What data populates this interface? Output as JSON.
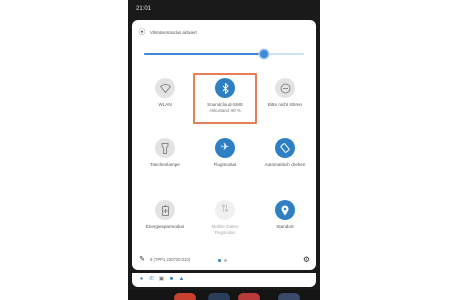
{
  "status_bar": {
    "time": "21:01"
  },
  "vibrate": {
    "label": "Vibrationsmodus aktiviert",
    "icon": "vibrate-icon"
  },
  "brightness": {
    "level": 0.75,
    "track_color": "#cfe2f3",
    "fill_color": "#3d8ad8"
  },
  "tiles": [
    {
      "label": "WLAN",
      "icon": "wifi-icon",
      "active": false
    },
    {
      "label": "Soundcloud-SMS",
      "sublabel": "Akkustand: 80 %",
      "icon": "bluetooth-icon",
      "active": true,
      "highlighted": true
    },
    {
      "label": "Bitte nicht stören",
      "icon": "dnd-icon",
      "active": false
    },
    {
      "label": "Taschenlampe",
      "icon": "flashlight-icon",
      "active": false
    },
    {
      "label": "Flugmodus",
      "icon": "airplane-icon",
      "active": true
    },
    {
      "label": "Automatisch drehen",
      "icon": "rotate-icon",
      "active": true
    },
    {
      "label": "Energiesparmodus",
      "icon": "battery-saver-icon",
      "active": false
    },
    {
      "label": "Mobile Daten",
      "sublabel": "Flugmodus",
      "icon": "mobile-data-icon",
      "active": false,
      "dim": true
    },
    {
      "label": "Standort",
      "icon": "location-icon",
      "active": true
    }
  ],
  "footer": {
    "build": "9 (TPP1.220720.010)",
    "edit_icon": "pencil-icon",
    "settings_icon": "gear-icon",
    "page_dots": {
      "active_color": "#2f7fc5",
      "inactive_color": "#bbbbbb"
    }
  },
  "notifications": {
    "icons": [
      {
        "name": "messenger-icon",
        "color": "#2f7fc5"
      },
      {
        "name": "phone-icon",
        "color": "#2f7fc5"
      },
      {
        "name": "lock-icon",
        "color": "#777777"
      },
      {
        "name": "app-icon",
        "color": "#2f7fc5"
      },
      {
        "name": "app-icon",
        "color": "#2f7fc5"
      }
    ]
  },
  "colors": {
    "accent": "#2f7fc5",
    "highlight_border": "#e87e55",
    "tile_inactive": "#e3e3e3",
    "phone_bg": "#1a1a1a"
  }
}
